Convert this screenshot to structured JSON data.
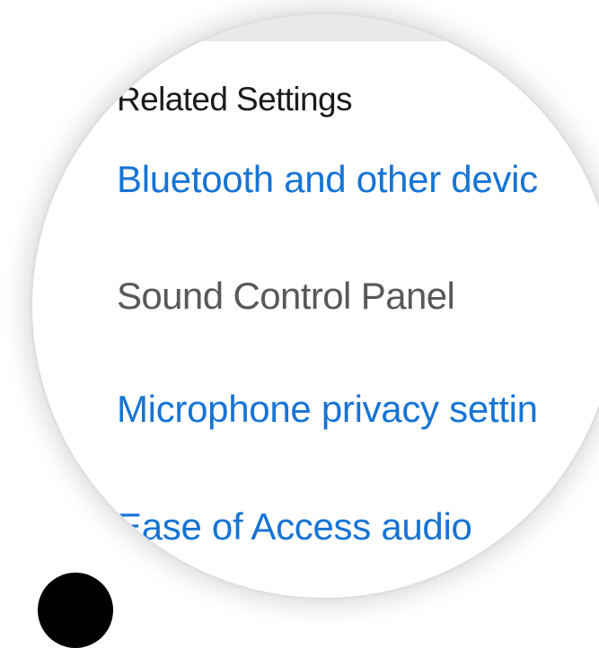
{
  "related_settings": {
    "heading": "Related Settings",
    "links": [
      {
        "label": "Bluetooth and other devic",
        "color": "#1674d4"
      },
      {
        "label": "Sound Control Panel",
        "color": "#585858"
      },
      {
        "label": "Microphone privacy settin",
        "color": "#1674d4"
      },
      {
        "label": "Ease of Access audio",
        "color": "#1674d4"
      }
    ]
  }
}
